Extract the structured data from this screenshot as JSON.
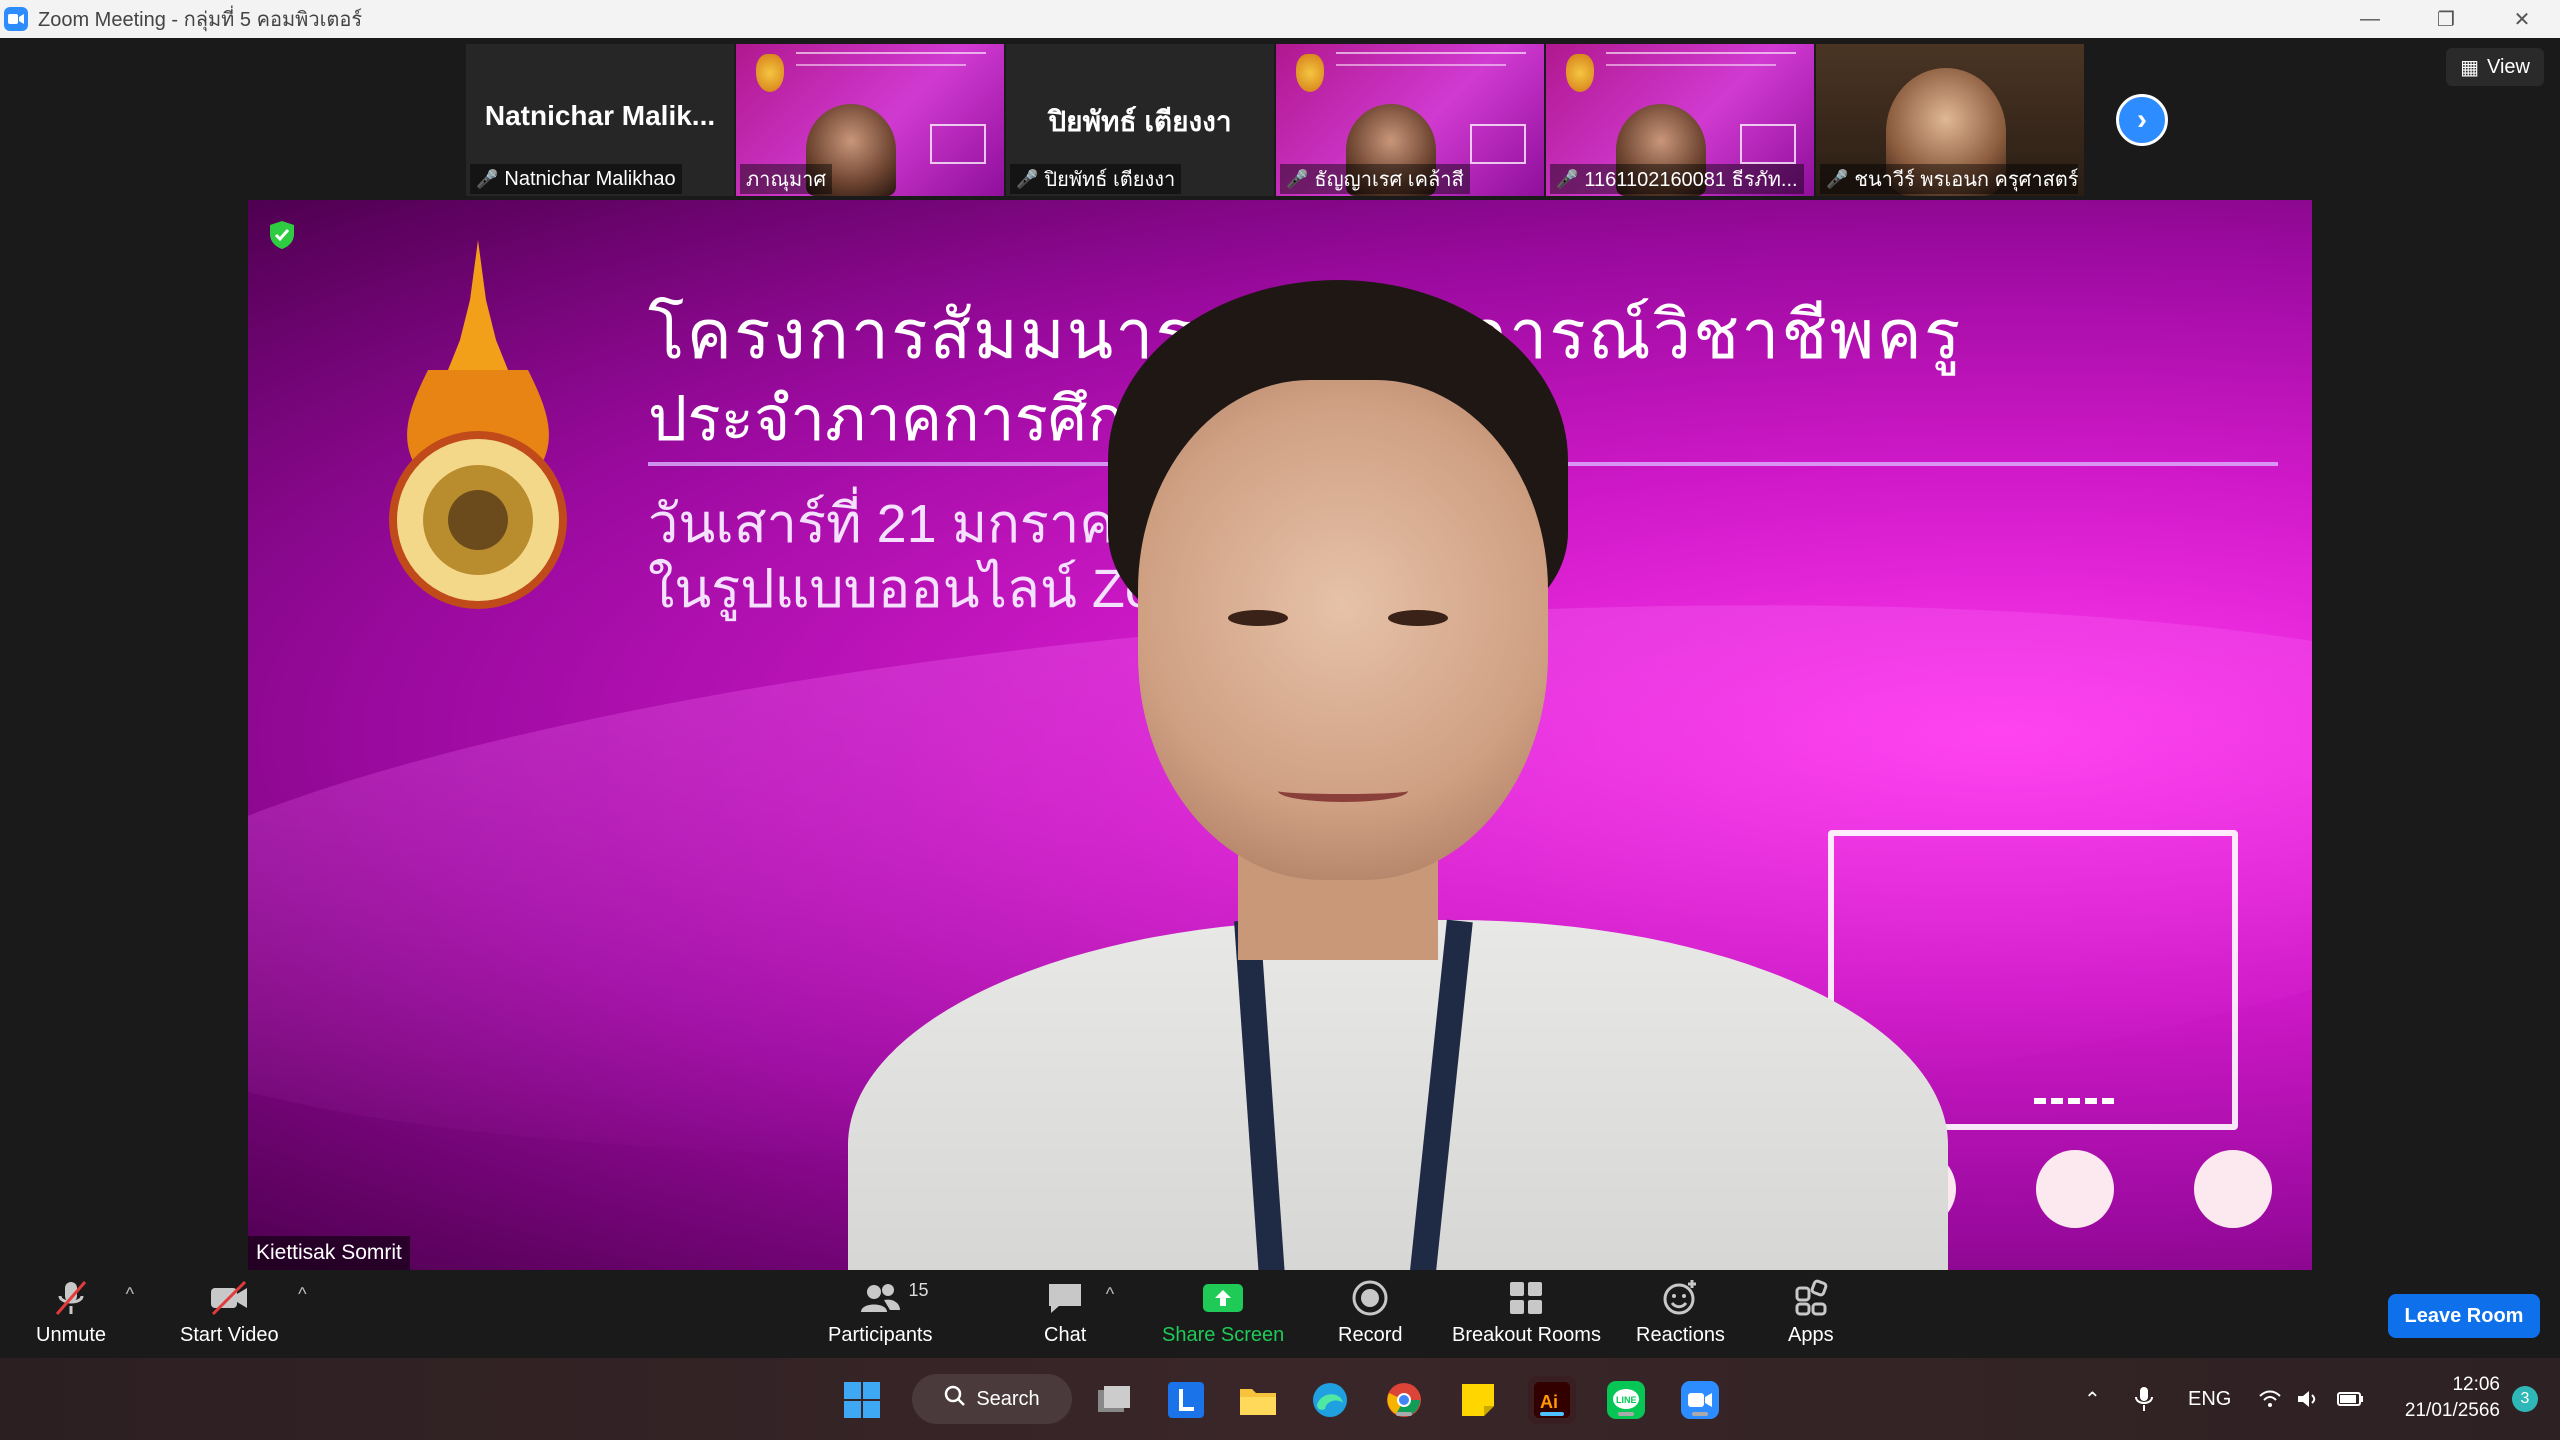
{
  "window": {
    "title": "Zoom Meeting - กลุ่มที่ 5 คอมพิวเตอร์",
    "icon": "zoom-icon"
  },
  "participants_strip": [
    {
      "big_name": "Natnichar  Malik...",
      "name": "Natnichar Malikhao",
      "type": "avatar",
      "muted": true
    },
    {
      "big_name": "",
      "name": "ภาณุมาศ",
      "type": "slide-face",
      "muted": false
    },
    {
      "big_name": "ปิยพัทธ์ เตียงงา",
      "name": "ปิยพัทธ์ เตียงงา",
      "type": "avatar",
      "muted": true
    },
    {
      "big_name": "",
      "name": "ธัญญาเรศ เคล้าสี",
      "type": "slide-face",
      "muted": true
    },
    {
      "big_name": "",
      "name": "1161102160081 ธีรภัท...",
      "type": "slide-face",
      "muted": true
    },
    {
      "big_name": "",
      "name": "ชนาวีร์ พรเอนก ครุศาสตร์...",
      "type": "camera",
      "muted": true
    }
  ],
  "view_button": "View",
  "main_video": {
    "speaker_name": "Kiettisak Somrit",
    "slide": {
      "line1": "โครงการสัมมนาระห             ระสบการณ์วิชาชีพครู",
      "line2": "ประจำภาคการศึก",
      "line3": "วันเสาร์ที่ 21 มกราคม                        – 16.00 น.",
      "line4": "ในรูปแบบออนไลน์ Zo                        e"
    }
  },
  "toolbar": {
    "unmute": "Unmute",
    "start_video": "Start Video",
    "participants": "Participants",
    "participants_count": "15",
    "chat": "Chat",
    "share_screen": "Share Screen",
    "record": "Record",
    "breakout_rooms": "Breakout Rooms",
    "reactions": "Reactions",
    "apps": "Apps",
    "leave_room": "Leave Room"
  },
  "taskbar": {
    "search": "Search",
    "language": "ENG",
    "time": "12:06",
    "date": "21/01/2566",
    "notification_count": "3"
  },
  "colors": {
    "zoom_blue": "#0e71eb",
    "share_green": "#1fca57",
    "slide_magenta": "#d019c9",
    "muted_red": "#e23b3b"
  }
}
